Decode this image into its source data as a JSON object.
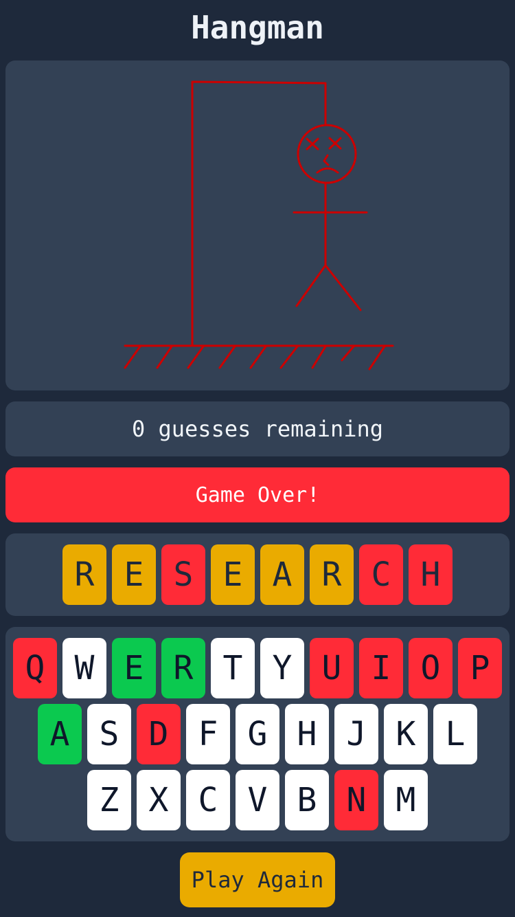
{
  "title": "Hangman",
  "status": "0 guesses remaining",
  "banner": "Game Over!",
  "colors": {
    "background": "#1e293b",
    "panel": "#334155",
    "drawing": "#cc0000",
    "wrong": "#ff2b37",
    "correct": "#0bc94f",
    "revealed": "#eaab00",
    "unused": "#ffffff"
  },
  "word": [
    {
      "letter": "R",
      "state": "orange"
    },
    {
      "letter": "E",
      "state": "orange"
    },
    {
      "letter": "S",
      "state": "red"
    },
    {
      "letter": "E",
      "state": "orange"
    },
    {
      "letter": "A",
      "state": "orange"
    },
    {
      "letter": "R",
      "state": "orange"
    },
    {
      "letter": "C",
      "state": "red"
    },
    {
      "letter": "H",
      "state": "red"
    }
  ],
  "keyboard": {
    "row1": [
      {
        "key": "Q",
        "state": "wrong"
      },
      {
        "key": "W",
        "state": "unused"
      },
      {
        "key": "E",
        "state": "right"
      },
      {
        "key": "R",
        "state": "right"
      },
      {
        "key": "T",
        "state": "unused"
      },
      {
        "key": "Y",
        "state": "unused"
      },
      {
        "key": "U",
        "state": "wrong"
      },
      {
        "key": "I",
        "state": "wrong"
      },
      {
        "key": "O",
        "state": "wrong"
      },
      {
        "key": "P",
        "state": "wrong"
      }
    ],
    "row2": [
      {
        "key": "A",
        "state": "right"
      },
      {
        "key": "S",
        "state": "unused"
      },
      {
        "key": "D",
        "state": "wrong"
      },
      {
        "key": "F",
        "state": "unused"
      },
      {
        "key": "G",
        "state": "unused"
      },
      {
        "key": "H",
        "state": "unused"
      },
      {
        "key": "J",
        "state": "unused"
      },
      {
        "key": "K",
        "state": "unused"
      },
      {
        "key": "L",
        "state": "unused"
      }
    ],
    "row3": [
      {
        "key": "Z",
        "state": "unused"
      },
      {
        "key": "X",
        "state": "unused"
      },
      {
        "key": "C",
        "state": "unused"
      },
      {
        "key": "V",
        "state": "unused"
      },
      {
        "key": "B",
        "state": "unused"
      },
      {
        "key": "N",
        "state": "wrong"
      },
      {
        "key": "M",
        "state": "unused"
      }
    ]
  },
  "play_again": "Play Again"
}
